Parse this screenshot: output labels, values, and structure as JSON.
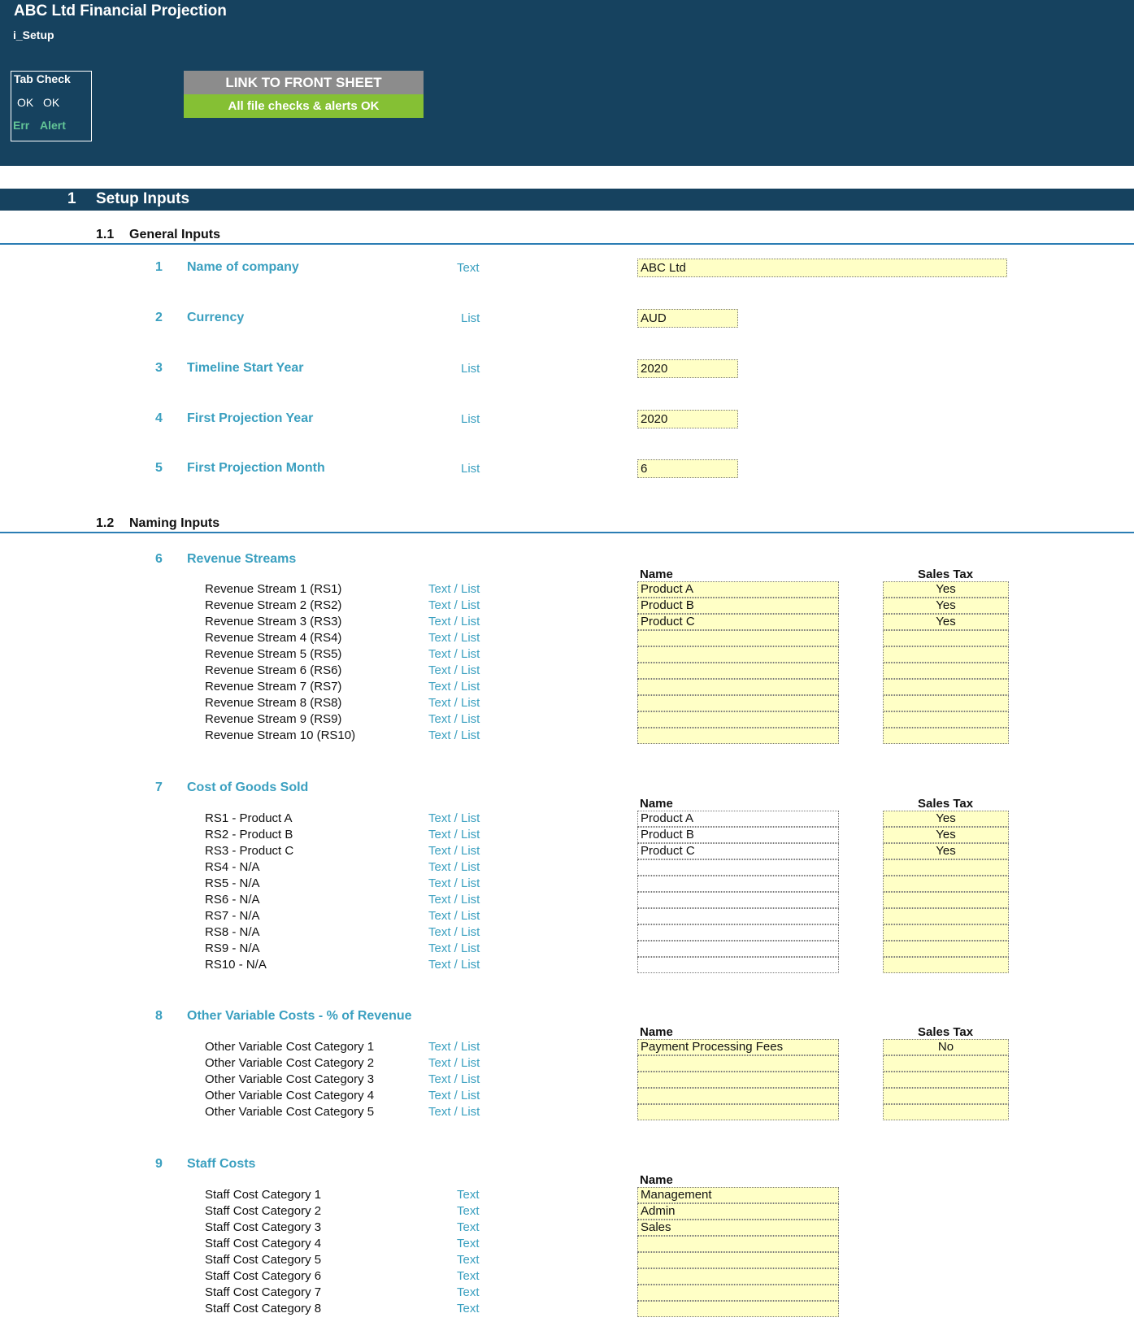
{
  "header": {
    "title": "ABC Ltd Financial Projection",
    "sheet": "i_Setup",
    "tab_check": {
      "title": "Tab Check",
      "ok1": "OK",
      "ok2": "OK",
      "err": "Err",
      "alert": "Alert"
    },
    "link_button": "LINK TO FRONT SHEET",
    "status": "All file checks & alerts OK"
  },
  "section": {
    "number": "1",
    "title": "Setup Inputs"
  },
  "general": {
    "number": "1.1",
    "title": "General Inputs",
    "items": [
      {
        "num": "1",
        "label": "Name of company",
        "type": "Text",
        "value": "ABC Ltd"
      },
      {
        "num": "2",
        "label": "Currency",
        "type": "List",
        "value": "AUD"
      },
      {
        "num": "3",
        "label": "Timeline Start Year",
        "type": "List",
        "value": "2020"
      },
      {
        "num": "4",
        "label": "First Projection Year",
        "type": "List",
        "value": "2020"
      },
      {
        "num": "5",
        "label": "First Projection Month",
        "type": "List",
        "value": "6"
      }
    ]
  },
  "naming": {
    "number": "1.2",
    "title": "Naming Inputs"
  },
  "blocks": [
    {
      "num": "6",
      "title": "Revenue Streams",
      "name_header": "Name",
      "tax_header": "Sales Tax",
      "name_style": "yellow",
      "rows": [
        {
          "label": "Revenue Stream 1 (RS1)",
          "type": "Text / List",
          "name": "Product A",
          "tax": "Yes"
        },
        {
          "label": "Revenue Stream 2 (RS2)",
          "type": "Text / List",
          "name": "Product B",
          "tax": "Yes"
        },
        {
          "label": "Revenue Stream 3 (RS3)",
          "type": "Text / List",
          "name": "Product C",
          "tax": "Yes"
        },
        {
          "label": "Revenue Stream 4 (RS4)",
          "type": "Text / List",
          "name": "",
          "tax": ""
        },
        {
          "label": "Revenue Stream 5 (RS5)",
          "type": "Text / List",
          "name": "",
          "tax": ""
        },
        {
          "label": "Revenue Stream 6 (RS6)",
          "type": "Text / List",
          "name": "",
          "tax": ""
        },
        {
          "label": "Revenue Stream 7 (RS7)",
          "type": "Text / List",
          "name": "",
          "tax": ""
        },
        {
          "label": "Revenue Stream 8 (RS8)",
          "type": "Text / List",
          "name": "",
          "tax": ""
        },
        {
          "label": "Revenue Stream 9 (RS9)",
          "type": "Text / List",
          "name": "",
          "tax": ""
        },
        {
          "label": "Revenue Stream 10 (RS10)",
          "type": "Text / List",
          "name": "",
          "tax": ""
        }
      ]
    },
    {
      "num": "7",
      "title": "Cost of Goods Sold",
      "name_header": "Name",
      "tax_header": "Sales Tax",
      "name_style": "white",
      "rows": [
        {
          "label": "RS1 - Product A",
          "type": "Text / List",
          "name": "Product A",
          "tax": "Yes"
        },
        {
          "label": "RS2 - Product B",
          "type": "Text / List",
          "name": "Product B",
          "tax": "Yes"
        },
        {
          "label": "RS3 - Product C",
          "type": "Text / List",
          "name": "Product C",
          "tax": "Yes"
        },
        {
          "label": "RS4 - N/A",
          "type": "Text / List",
          "name": "",
          "tax": ""
        },
        {
          "label": "RS5 - N/A",
          "type": "Text / List",
          "name": "",
          "tax": ""
        },
        {
          "label": "RS6 - N/A",
          "type": "Text / List",
          "name": "",
          "tax": ""
        },
        {
          "label": "RS7 - N/A",
          "type": "Text / List",
          "name": "",
          "tax": ""
        },
        {
          "label": "RS8 - N/A",
          "type": "Text / List",
          "name": "",
          "tax": ""
        },
        {
          "label": "RS9 - N/A",
          "type": "Text / List",
          "name": "",
          "tax": ""
        },
        {
          "label": "RS10 - N/A",
          "type": "Text / List",
          "name": "",
          "tax": ""
        }
      ]
    },
    {
      "num": "8",
      "title": "Other Variable Costs - % of Revenue",
      "name_header": "Name",
      "tax_header": "Sales Tax",
      "name_style": "yellow",
      "rows": [
        {
          "label": "Other Variable Cost Category 1",
          "type": "Text / List",
          "name": "Payment Processing Fees",
          "tax": "No"
        },
        {
          "label": "Other Variable Cost Category 2",
          "type": "Text / List",
          "name": "",
          "tax": ""
        },
        {
          "label": "Other Variable Cost Category 3",
          "type": "Text / List",
          "name": "",
          "tax": ""
        },
        {
          "label": "Other Variable Cost Category 4",
          "type": "Text / List",
          "name": "",
          "tax": ""
        },
        {
          "label": "Other Variable Cost Category 5",
          "type": "Text / List",
          "name": "",
          "tax": ""
        }
      ]
    },
    {
      "num": "9",
      "title": "Staff Costs",
      "name_header": "Name",
      "tax_header": "",
      "name_style": "yellow",
      "rows": [
        {
          "label": "Staff Cost Category 1",
          "type": "Text",
          "name": "Management"
        },
        {
          "label": "Staff Cost Category 2",
          "type": "Text",
          "name": "Admin"
        },
        {
          "label": "Staff Cost Category 3",
          "type": "Text",
          "name": "Sales"
        },
        {
          "label": "Staff Cost Category 4",
          "type": "Text",
          "name": ""
        },
        {
          "label": "Staff Cost Category 5",
          "type": "Text",
          "name": ""
        },
        {
          "label": "Staff Cost Category 6",
          "type": "Text",
          "name": ""
        },
        {
          "label": "Staff Cost Category 7",
          "type": "Text",
          "name": ""
        },
        {
          "label": "Staff Cost Category 8",
          "type": "Text",
          "name": ""
        }
      ]
    }
  ]
}
